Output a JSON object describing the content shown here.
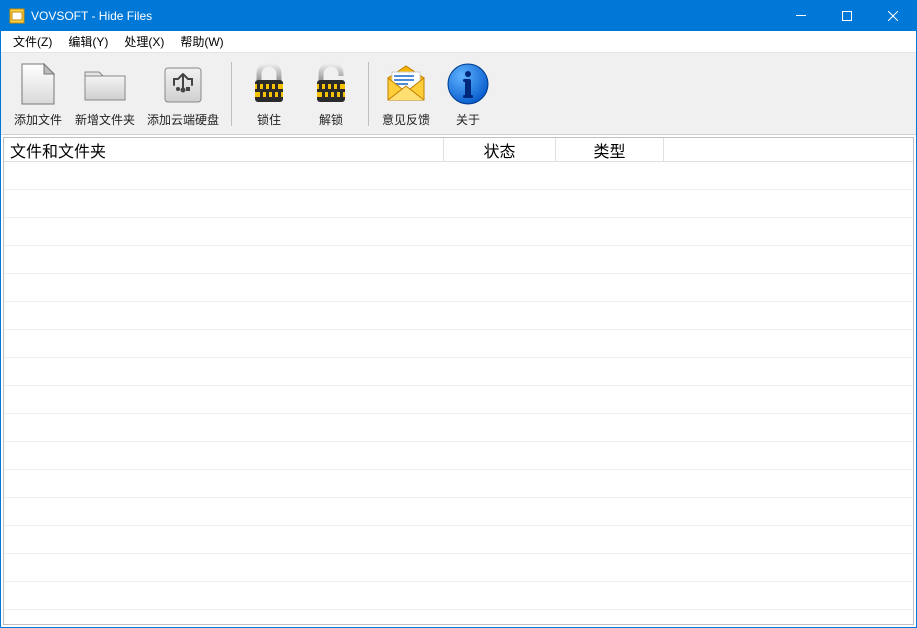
{
  "window": {
    "title": "VOVSOFT - Hide Files"
  },
  "menu": {
    "file": "文件(Z)",
    "edit": "编辑(Y)",
    "process": "处理(X)",
    "help": "帮助(W)"
  },
  "toolbar": {
    "add_file": "添加文件",
    "add_folder": "新增文件夹",
    "add_cloud": "添加云端硬盘",
    "lock": "锁住",
    "unlock": "解锁",
    "feedback": "意见反馈",
    "about": "关于"
  },
  "columns": {
    "files": "文件和文件夹",
    "status": "状态",
    "type": "类型"
  },
  "rows": []
}
